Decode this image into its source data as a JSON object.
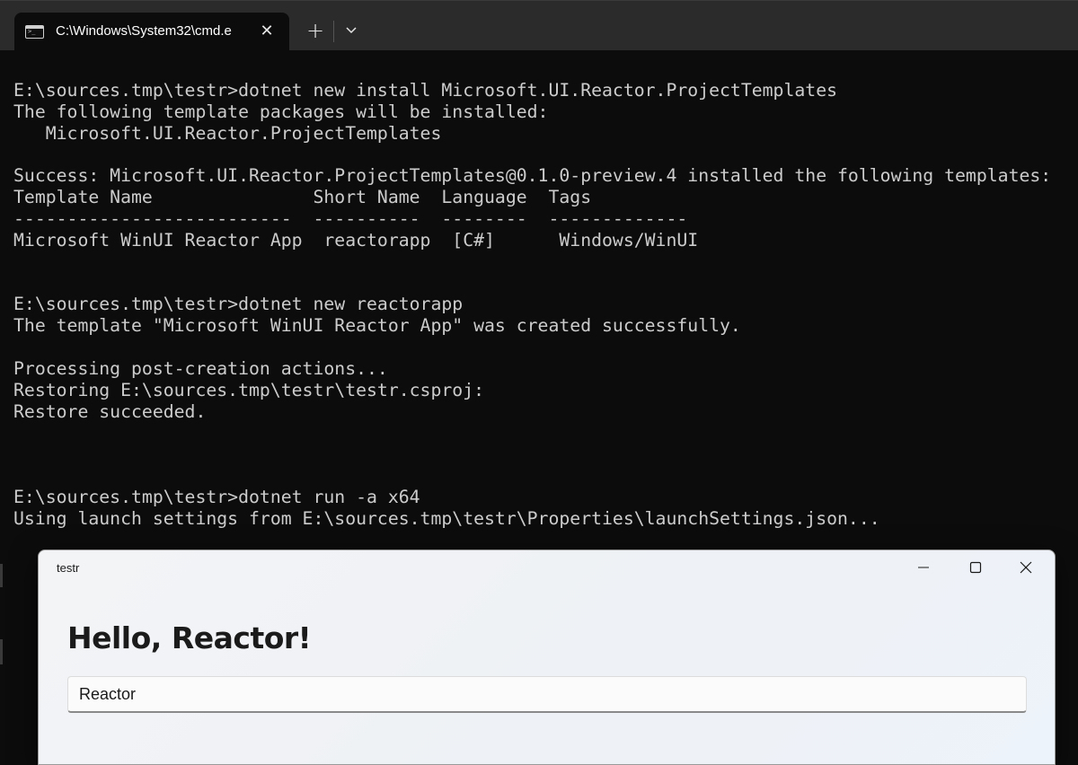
{
  "terminal": {
    "tab_title": "C:\\Windows\\System32\\cmd.e",
    "lines": [
      "E:\\sources.tmp\\testr>dotnet new install Microsoft.UI.Reactor.ProjectTemplates",
      "The following template packages will be installed:",
      "   Microsoft.UI.Reactor.ProjectTemplates",
      "",
      "Success: Microsoft.UI.Reactor.ProjectTemplates@0.1.0-preview.4 installed the following templates:",
      "Template Name               Short Name  Language  Tags",
      "--------------------------  ----------  --------  -------------",
      "Microsoft WinUI Reactor App  reactorapp  [C#]      Windows/WinUI",
      "",
      "",
      "E:\\sources.tmp\\testr>dotnet new reactorapp",
      "The template \"Microsoft WinUI Reactor App\" was created successfully.",
      "",
      "Processing post-creation actions...",
      "Restoring E:\\sources.tmp\\testr\\testr.csproj:",
      "Restore succeeded.",
      "",
      "",
      "",
      "E:\\sources.tmp\\testr>dotnet run -a x64",
      "Using launch settings from E:\\sources.tmp\\testr\\Properties\\launchSettings.json..."
    ]
  },
  "app": {
    "title": "testr",
    "heading": "Hello, Reactor!",
    "input_value": "Reactor"
  },
  "icons": {
    "tab_icon": "cmd-console-icon",
    "tab_close": "close-icon",
    "new_tab": "plus-icon",
    "dropdown": "chevron-down-icon",
    "minimize": "minimize-icon",
    "maximize": "maximize-icon",
    "close": "close-icon"
  },
  "colors": {
    "terminal_bg": "#0c0c0c",
    "terminal_text": "#cccccc",
    "titlebar_bg": "#2b2b2b",
    "app_bg": "#f3f4f6"
  }
}
